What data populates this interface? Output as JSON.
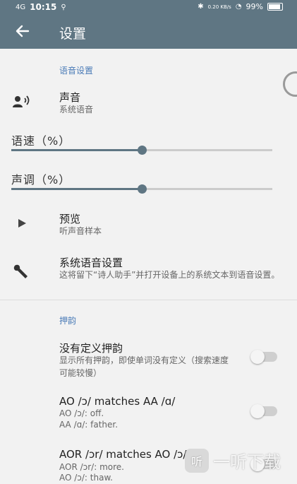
{
  "status": {
    "time": "10:15",
    "battery": "99%",
    "network_speed": "0.20 KB/s",
    "signal": "4G"
  },
  "appbar": {
    "title": "设置"
  },
  "voice_section": {
    "header": "语音设置"
  },
  "voice": {
    "title": "声音",
    "subtitle": "系统语音"
  },
  "speed": {
    "label": "语速（%）",
    "value_fraction": 0.5
  },
  "pitch": {
    "label": "声调（%）",
    "value_fraction": 0.5
  },
  "preview": {
    "title": "预览",
    "subtitle": "听声音样本"
  },
  "system_tts": {
    "title": "系统语音设置",
    "subtitle": "这将留下“诗人助手”并打开设备上的系统文本到语音设置。"
  },
  "rhyme_section": {
    "header": "押韵"
  },
  "rhymes": [
    {
      "title": "没有定义押韵",
      "subtitle": "显示所有押韵，即使单词没有定义（搜索速度可能较慢）",
      "enabled": false
    },
    {
      "title": "AO /ɔ/ matches AA /ɑ/",
      "line1": "AO /ɔ/: off.",
      "line2": "AA /ɑ/: father.",
      "enabled": false
    },
    {
      "title": "AOR /ɔr/ matches AO /ɔ/",
      "line1": "AOR /ɔr/: more.",
      "line2": "AO /ɔ/: thaw.",
      "enabled": false
    }
  ],
  "watermark": "一听下载",
  "colors": {
    "primary": "#5f7683",
    "accent": "#4a7bb7"
  },
  "icons": {
    "back": "arrow-left-icon",
    "voice": "voice-icon",
    "preview": "play-icon",
    "system": "wrench-icon"
  }
}
